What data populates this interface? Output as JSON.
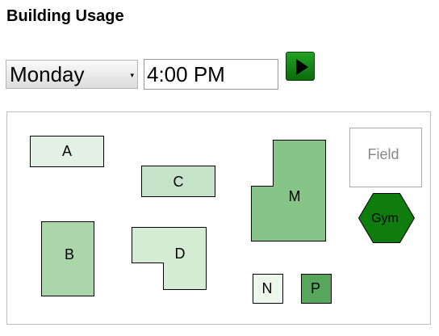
{
  "page": {
    "title": "Building Usage"
  },
  "controls": {
    "day_value": "Monday",
    "time_value": "4:00 PM"
  },
  "map": {
    "buildings": {
      "A": {
        "label": "A",
        "color": "#e2f0e6"
      },
      "B": {
        "label": "B",
        "color": "#abd6ab"
      },
      "C": {
        "label": "C",
        "color": "#c4e3c9"
      },
      "D": {
        "label": "D",
        "color": "#d4ebd4"
      },
      "M": {
        "label": "M",
        "color": "#86c487"
      },
      "N": {
        "label": "N",
        "color": "#ecf6ec"
      },
      "P": {
        "label": "P",
        "color": "#58a65c"
      },
      "Field": {
        "label": "Field",
        "color": "#ffffff",
        "text_color": "#888888",
        "border_color": "#aaaaaa"
      },
      "Gym": {
        "label": "Gym",
        "color": "#0e7d0e"
      }
    }
  }
}
